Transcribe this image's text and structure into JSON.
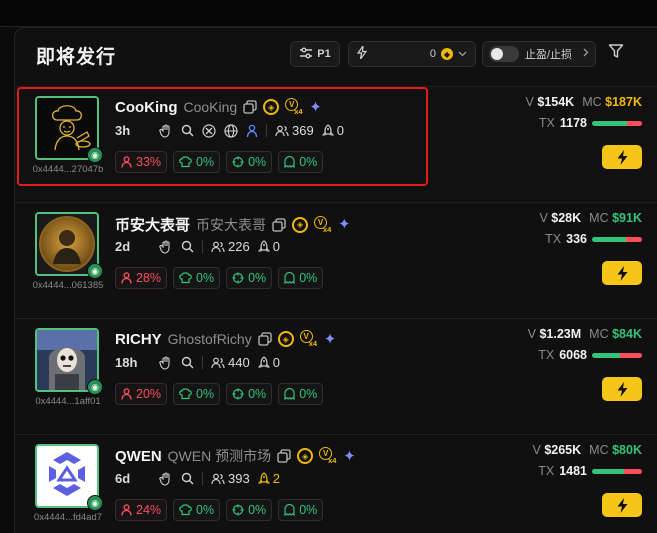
{
  "panel": {
    "title": "即将发行",
    "preset_label": "P1",
    "amount_value": "0",
    "tpsl_label": "止盈/止损"
  },
  "colors": {
    "accent_yellow": "#f5c518",
    "green": "#35c27a",
    "red": "#ff4d5e",
    "highlight_red": "#e01b1b",
    "mc_gold": "#f0b90b"
  },
  "tokens": [
    {
      "symbol": "CooKing",
      "name": "CooKing",
      "address": "0x4444...27047b",
      "age": "3h",
      "holders": "369",
      "snipers": "0",
      "top10": "33%",
      "dev_holdings": "0%",
      "insiders": "0%",
      "bundlers": "0%",
      "volume_label": "V",
      "volume": "$154K",
      "mc_label": "MC",
      "mc": "$187K",
      "mc_color": "#f0b90b",
      "tx_label": "TX",
      "tx": "1178",
      "buy_ratio": 0.7,
      "extra_icons": [
        "twitter-icon",
        "website-icon",
        "person-icon"
      ]
    },
    {
      "symbol": "币安大表哥",
      "name": "币安大表哥",
      "address": "0x4444...061385",
      "age": "2d",
      "holders": "226",
      "snipers": "0",
      "top10": "28%",
      "dev_holdings": "0%",
      "insiders": "0%",
      "bundlers": "0%",
      "volume_label": "V",
      "volume": "$28K",
      "mc_label": "MC",
      "mc": "$91K",
      "mc_color": "#35c27a",
      "tx_label": "TX",
      "tx": "336",
      "buy_ratio": 0.68,
      "extra_icons": []
    },
    {
      "symbol": "RICHY",
      "name": "GhostofRichy",
      "address": "0x4444...1aff01",
      "age": "18h",
      "holders": "440",
      "snipers": "0",
      "top10": "20%",
      "dev_holdings": "0%",
      "insiders": "0%",
      "bundlers": "0%",
      "volume_label": "V",
      "volume": "$1.23M",
      "mc_label": "MC",
      "mc": "$84K",
      "mc_color": "#35c27a",
      "tx_label": "TX",
      "tx": "6068",
      "buy_ratio": 0.55,
      "extra_icons": []
    },
    {
      "symbol": "QWEN",
      "name": "QWEN 预测市场",
      "address": "0x4444...fd4ad7",
      "age": "6d",
      "holders": "393",
      "snipers": "2",
      "top10": "24%",
      "dev_holdings": "0%",
      "insiders": "0%",
      "bundlers": "0%",
      "volume_label": "V",
      "volume": "$265K",
      "mc_label": "MC",
      "mc": "$80K",
      "mc_color": "#35c27a",
      "tx_label": "TX",
      "tx": "1481",
      "buy_ratio": 0.64,
      "extra_icons": []
    }
  ]
}
